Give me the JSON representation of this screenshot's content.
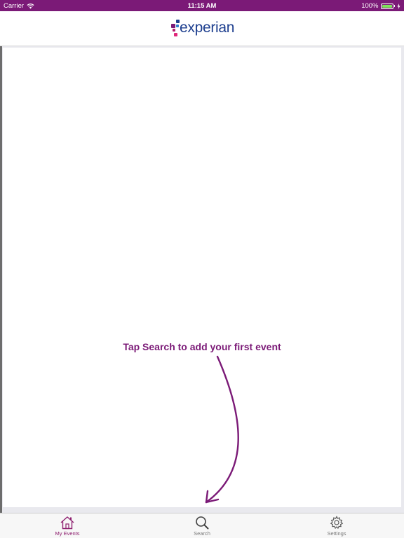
{
  "status_bar": {
    "carrier": "Carrier",
    "time": "11:15 AM",
    "battery_level": "100%",
    "battery_fraction": 1.0,
    "wifi_icon": "wifi-icon"
  },
  "header": {
    "logo_text": "experian",
    "logo_mark": "."
  },
  "content": {
    "empty_hint": "Tap Search to add your first event",
    "arrow_icon": "curved-arrow-down-icon"
  },
  "tabs": [
    {
      "label": "My Events",
      "icon": "home-icon",
      "selected": true
    },
    {
      "label": "Search",
      "icon": "search-icon",
      "selected": false
    },
    {
      "label": "Settings",
      "icon": "gear-icon",
      "selected": false
    }
  ],
  "colors": {
    "brand_purple": "#7b1a77",
    "logo_blue": "#1e3f8f",
    "tab_active": "#8e1f6f",
    "tab_inactive": "#7a7a7a"
  }
}
